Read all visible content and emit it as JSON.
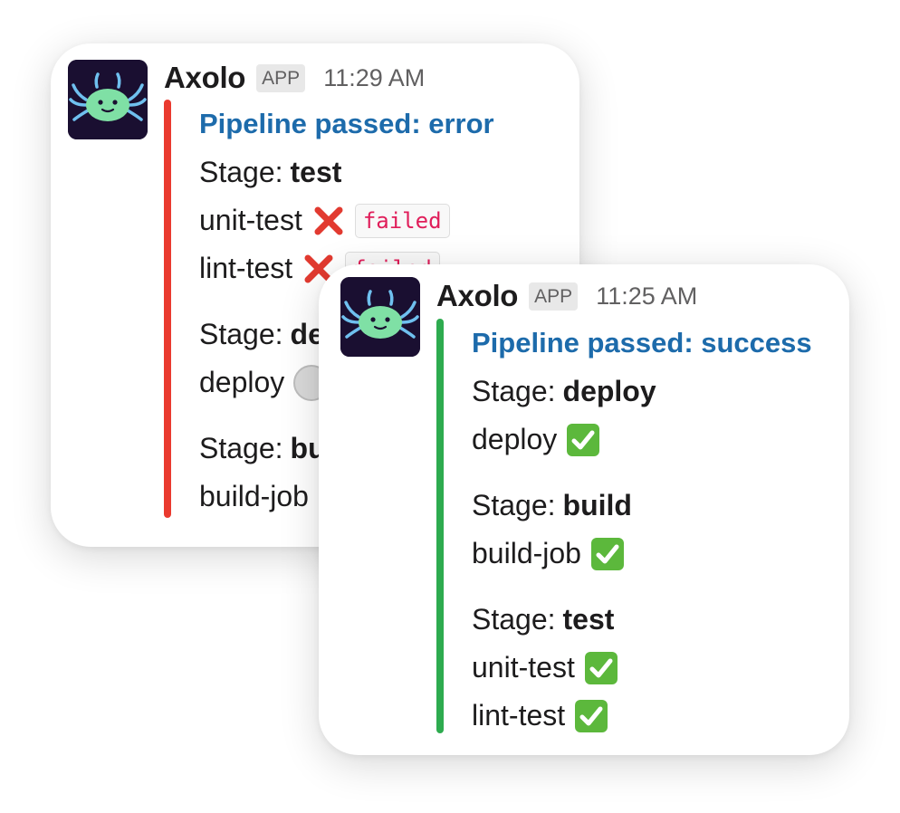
{
  "messages": [
    {
      "sender": "Axolo",
      "badge": "APP",
      "time": "11:29 AM",
      "title": "Pipeline passed: error",
      "stage_prefix": "Stage:",
      "stages": [
        {
          "name": "test",
          "jobs": [
            {
              "name": "unit-test",
              "status": "failed",
              "status_label": "failed"
            },
            {
              "name": "lint-test",
              "status": "failed",
              "status_label": "failed"
            }
          ]
        },
        {
          "name": "deploy",
          "jobs": [
            {
              "name": "deploy",
              "status": "pending"
            }
          ]
        },
        {
          "name": "build",
          "jobs": [
            {
              "name": "build-job",
              "status": "success"
            }
          ]
        }
      ],
      "accent_color": "#ea3a2f"
    },
    {
      "sender": "Axolo",
      "badge": "APP",
      "time": "11:25 AM",
      "title": "Pipeline passed: success",
      "stage_prefix": "Stage:",
      "stages": [
        {
          "name": "deploy",
          "jobs": [
            {
              "name": "deploy",
              "status": "success"
            }
          ]
        },
        {
          "name": "build",
          "jobs": [
            {
              "name": "build-job",
              "status": "success"
            }
          ]
        },
        {
          "name": "test",
          "jobs": [
            {
              "name": "unit-test",
              "status": "success"
            },
            {
              "name": "lint-test",
              "status": "success"
            }
          ]
        }
      ],
      "accent_color": "#2eab4f"
    }
  ],
  "icons": {
    "avatar": "axolotl-avatar-icon",
    "failed": "cross-mark-icon",
    "success": "check-mark-icon",
    "pending": "pending-circle-icon"
  }
}
